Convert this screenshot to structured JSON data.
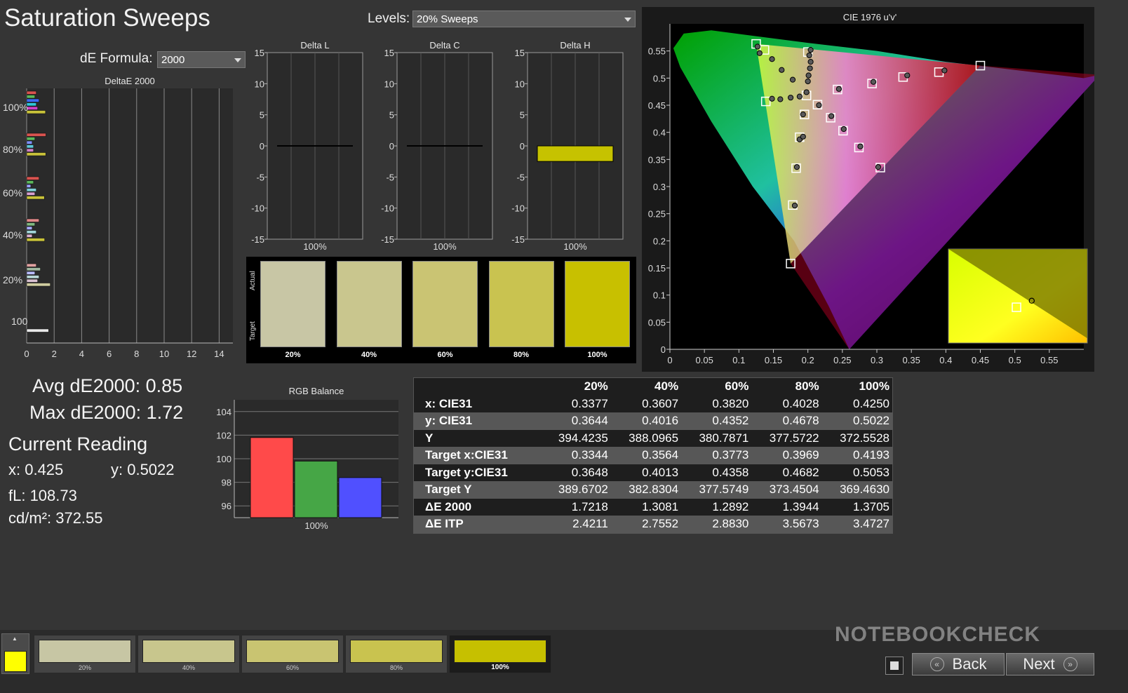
{
  "page_title": "Saturation Sweeps",
  "levels": {
    "label": "Levels:",
    "value": "20% Sweeps"
  },
  "de_formula": {
    "label": "dE Formula:",
    "value": "2000"
  },
  "deltae_chart": {
    "title": "DeltaE 2000",
    "x_ticks": [
      "0",
      "2",
      "4",
      "6",
      "8",
      "10",
      "12",
      "14"
    ],
    "y_labels": [
      "100%",
      "80%",
      "60%",
      "40%",
      "20%",
      "100"
    ],
    "xlim": [
      0,
      15
    ],
    "groups": [
      {
        "label": "100%",
        "values": [
          {
            "v": 0.7,
            "c": "#d9534f"
          },
          {
            "v": 0.6,
            "c": "#5cb85c"
          },
          {
            "v": 0.9,
            "c": "#3d6bff"
          },
          {
            "v": 0.7,
            "c": "#30c8d8"
          },
          {
            "v": 0.8,
            "c": "#d040c8"
          },
          {
            "v": 1.37,
            "c": "#c9c33a"
          }
        ]
      },
      {
        "label": "80%",
        "values": [
          {
            "v": 1.4,
            "c": "#d9534f"
          },
          {
            "v": 0.6,
            "c": "#5cb85c"
          },
          {
            "v": 0.4,
            "c": "#8090ff"
          },
          {
            "v": 0.5,
            "c": "#60c8d8"
          },
          {
            "v": 0.5,
            "c": "#d080c8"
          },
          {
            "v": 1.39,
            "c": "#c9c33a"
          }
        ]
      },
      {
        "label": "60%",
        "values": [
          {
            "v": 0.9,
            "c": "#d9534f"
          },
          {
            "v": 0.5,
            "c": "#5cb85c"
          },
          {
            "v": 0.3,
            "c": "#9aa0ff"
          },
          {
            "v": 0.7,
            "c": "#80d0d8"
          },
          {
            "v": 0.6,
            "c": "#d8a0d0"
          },
          {
            "v": 1.29,
            "c": "#c9c33a"
          }
        ]
      },
      {
        "label": "40%",
        "values": [
          {
            "v": 0.9,
            "c": "#e08888"
          },
          {
            "v": 0.6,
            "c": "#80b880"
          },
          {
            "v": 0.4,
            "c": "#a8acff"
          },
          {
            "v": 0.7,
            "c": "#a0d4d8"
          },
          {
            "v": 0.4,
            "c": "#d8b0d0"
          },
          {
            "v": 1.31,
            "c": "#c9c33a"
          }
        ]
      },
      {
        "label": "20%",
        "values": [
          {
            "v": 0.7,
            "c": "#e0a0a0"
          },
          {
            "v": 1.0,
            "c": "#a0b8a0"
          },
          {
            "v": 0.6,
            "c": "#b8bcff"
          },
          {
            "v": 0.9,
            "c": "#b8d8d8"
          },
          {
            "v": 0.8,
            "c": "#d8c0d0"
          },
          {
            "v": 1.72,
            "c": "#cfcca0"
          }
        ]
      },
      {
        "label": "100",
        "values": [
          {
            "v": 1.6,
            "c": "#e8e8e8"
          }
        ]
      }
    ]
  },
  "delta_charts": [
    {
      "title": "Delta L",
      "value": 0.0,
      "category": "100%"
    },
    {
      "title": "Delta C",
      "value": 0.0,
      "category": "100%"
    },
    {
      "title": "Delta H",
      "value": -2.5,
      "category": "100%"
    }
  ],
  "delta_y_ticks": [
    "15",
    "10",
    "5",
    "0",
    "-5",
    "-10",
    "-15"
  ],
  "swatches": {
    "side_labels": [
      "Actual",
      "Target"
    ],
    "items": [
      {
        "label": "20%",
        "color": "#c8c6a5"
      },
      {
        "label": "40%",
        "color": "#c9c68e"
      },
      {
        "label": "60%",
        "color": "#cac473"
      },
      {
        "label": "80%",
        "color": "#c9c350"
      },
      {
        "label": "100%",
        "color": "#c8c000"
      }
    ]
  },
  "stats": {
    "avg": "Avg dE2000: 0.85",
    "max": "Max dE2000: 1.72",
    "current_reading_title": "Current Reading",
    "x": "x: 0.425",
    "y": "y: 0.5022",
    "fl": "fL: 108.73",
    "cdm2": "cd/m²: 372.55"
  },
  "rgb_balance": {
    "title": "RGB Balance",
    "category": "100%",
    "y_ticks": [
      "104",
      "102",
      "100",
      "98",
      "96"
    ],
    "ylim": [
      95,
      105
    ],
    "bars": [
      {
        "name": "R",
        "value": 101.8,
        "color": "#ff4a4a"
      },
      {
        "name": "G",
        "value": 99.8,
        "color": "#46a646"
      },
      {
        "name": "B",
        "value": 98.4,
        "color": "#5050ff"
      }
    ]
  },
  "table": {
    "headers": [
      "",
      "20%",
      "40%",
      "60%",
      "80%",
      "100%"
    ],
    "rows": [
      [
        "x: CIE31",
        "0.3377",
        "0.3607",
        "0.3820",
        "0.4028",
        "0.4250"
      ],
      [
        "y: CIE31",
        "0.3644",
        "0.4016",
        "0.4352",
        "0.4678",
        "0.5022"
      ],
      [
        "Y",
        "394.4235",
        "388.0965",
        "380.7871",
        "377.5722",
        "372.5528"
      ],
      [
        "Target x:CIE31",
        "0.3344",
        "0.3564",
        "0.3773",
        "0.3969",
        "0.4193"
      ],
      [
        "Target y:CIE31",
        "0.3648",
        "0.4013",
        "0.4358",
        "0.4682",
        "0.5053"
      ],
      [
        "Target Y",
        "389.6702",
        "382.8304",
        "377.5749",
        "373.4504",
        "369.4630"
      ],
      [
        "ΔE 2000",
        "1.7218",
        "1.3081",
        "1.2892",
        "1.3944",
        "1.3705"
      ],
      [
        "ΔE ITP",
        "2.4211",
        "2.7552",
        "2.8830",
        "3.5673",
        "3.4727"
      ]
    ]
  },
  "cie": {
    "title": "CIE 1976 u'v'",
    "x_ticks": [
      "0",
      "0.05",
      "0.1",
      "0.15",
      "0.2",
      "0.25",
      "0.3",
      "0.35",
      "0.4",
      "0.45",
      "0.5",
      "0.55"
    ],
    "y_ticks": [
      "0.55",
      "0.5",
      "0.45",
      "0.4",
      "0.35",
      "0.3",
      "0.25",
      "0.2",
      "0.15",
      "0.1",
      "0.05",
      "0"
    ],
    "xlim": [
      0,
      0.6
    ],
    "ylim": [
      0,
      0.6
    ],
    "targets": [
      [
        0.125,
        0.563
      ],
      [
        0.45,
        0.523
      ],
      [
        0.175,
        0.158
      ],
      [
        0.2,
        0.548
      ],
      [
        0.198,
        0.468
      ],
      [
        0.139,
        0.457
      ],
      [
        0.137,
        0.552
      ],
      [
        0.188,
        0.391
      ],
      [
        0.305,
        0.335
      ],
      [
        0.183,
        0.334
      ],
      [
        0.39,
        0.511
      ],
      [
        0.338,
        0.502
      ],
      [
        0.293,
        0.49
      ],
      [
        0.243,
        0.479
      ],
      [
        0.251,
        0.403
      ],
      [
        0.274,
        0.372
      ],
      [
        0.195,
        0.433
      ],
      [
        0.214,
        0.451
      ],
      [
        0.233,
        0.427
      ],
      [
        0.178,
        0.266
      ]
    ],
    "measured": [
      [
        0.127,
        0.558
      ],
      [
        0.398,
        0.514
      ],
      [
        0.181,
        0.265
      ],
      [
        0.204,
        0.552
      ],
      [
        0.202,
        0.542
      ],
      [
        0.204,
        0.53
      ],
      [
        0.203,
        0.518
      ],
      [
        0.201,
        0.505
      ],
      [
        0.2,
        0.494
      ],
      [
        0.198,
        0.474
      ],
      [
        0.13,
        0.546
      ],
      [
        0.148,
        0.535
      ],
      [
        0.162,
        0.515
      ],
      [
        0.178,
        0.497
      ],
      [
        0.148,
        0.462
      ],
      [
        0.16,
        0.461
      ],
      [
        0.175,
        0.464
      ],
      [
        0.188,
        0.466
      ],
      [
        0.193,
        0.433
      ],
      [
        0.216,
        0.45
      ],
      [
        0.234,
        0.43
      ],
      [
        0.252,
        0.406
      ],
      [
        0.276,
        0.374
      ],
      [
        0.302,
        0.336
      ],
      [
        0.188,
        0.387
      ],
      [
        0.184,
        0.336
      ],
      [
        0.245,
        0.48
      ],
      [
        0.295,
        0.493
      ],
      [
        0.344,
        0.505
      ],
      [
        0.193,
        0.392
      ]
    ],
    "inset_target": [
      0.49,
      0.62
    ],
    "inset_measured": [
      0.6,
      0.55
    ]
  },
  "bottom_bar": {
    "indicator_color": "#ffff00",
    "thumbs": [
      {
        "label": "20%",
        "color": "#c7c6a4"
      },
      {
        "label": "40%",
        "color": "#c8c68d"
      },
      {
        "label": "60%",
        "color": "#c9c471"
      },
      {
        "label": "80%",
        "color": "#c9c34f"
      },
      {
        "label": "100%",
        "color": "#c6c000"
      }
    ],
    "back_label": "Back",
    "next_label": "Next",
    "watermark": "NOTEBOOKCHECK"
  }
}
